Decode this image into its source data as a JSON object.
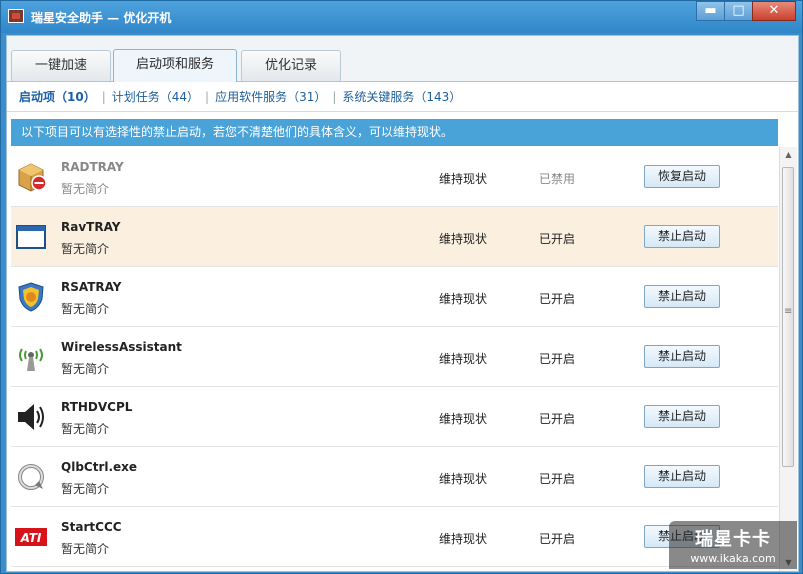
{
  "window": {
    "title": "瑞星安全助手 — 优化开机",
    "minimize": "▬",
    "maximize": "□",
    "close": "✕"
  },
  "tabs": [
    {
      "label": "一键加速"
    },
    {
      "label": "启动项和服务"
    },
    {
      "label": "优化记录"
    }
  ],
  "subnav": [
    {
      "label": "启动项（10）"
    },
    {
      "label": "计划任务（44）"
    },
    {
      "label": "应用软件服务（31）"
    },
    {
      "label": "系统关键服务（143）"
    }
  ],
  "notice": "以下项目可以有选择性的禁止启动，若您不清楚他们的具体含义，可以维持现状。",
  "rows": [
    {
      "name": "RADTRAY",
      "desc": "暂无简介",
      "action": "维持现状",
      "status": "已禁用",
      "button": "恢复启动",
      "icon": "box-blocked-icon"
    },
    {
      "name": "RavTRAY",
      "desc": "暂无简介",
      "action": "维持现状",
      "status": "已开启",
      "button": "禁止启动",
      "icon": "window-icon"
    },
    {
      "name": "RSATRAY",
      "desc": "暂无简介",
      "action": "维持现状",
      "status": "已开启",
      "button": "禁止启动",
      "icon": "shield-icon"
    },
    {
      "name": "WirelessAssistant",
      "desc": "暂无简介",
      "action": "维持现状",
      "status": "已开启",
      "button": "禁止启动",
      "icon": "wireless-icon"
    },
    {
      "name": "RTHDVCPL",
      "desc": "暂无简介",
      "action": "维持现状",
      "status": "已开启",
      "button": "禁止启动",
      "icon": "speaker-icon"
    },
    {
      "name": "QlbCtrl.exe",
      "desc": "暂无简介",
      "action": "维持现状",
      "status": "已开启",
      "button": "禁止启动",
      "icon": "refresh-icon"
    },
    {
      "name": "StartCCC",
      "desc": "暂无简介",
      "action": "维持现状",
      "status": "已开启",
      "button": "禁止启动",
      "icon": "ati-logo-icon"
    }
  ],
  "watermark": {
    "line1": "瑞星卡卡",
    "line2": "www.ikaka.com"
  },
  "colors": {
    "accent": "#3c8dc9",
    "notice": "#4aa3d8",
    "highlight": "#fbefdf"
  }
}
